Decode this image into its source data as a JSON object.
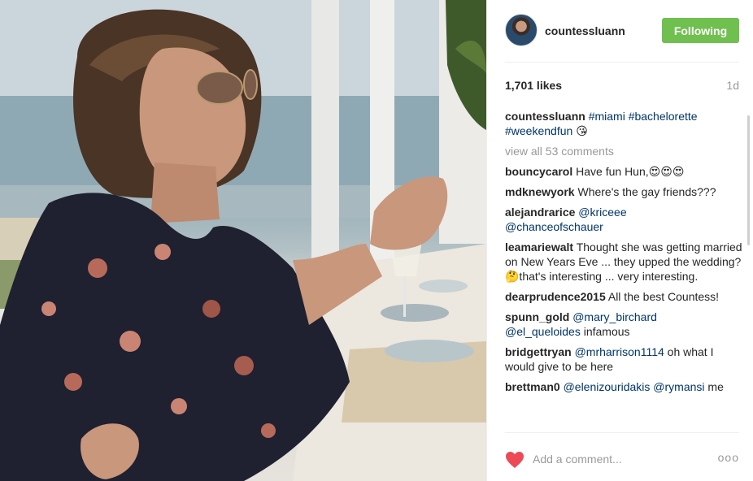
{
  "post": {
    "photo": {
      "subject": "photo"
    },
    "header": {
      "username": "countessluann",
      "follow_label": "Following",
      "avatar_icon": "avatar-icon"
    },
    "likes_label": "1,701 likes",
    "age_label": "1d",
    "caption": {
      "user": "countessluann",
      "tags": [
        "#miami",
        "#bachelorette",
        "#weekendfun"
      ],
      "emoji": "😘"
    },
    "view_all_label": "view all 53 comments",
    "comments": [
      {
        "user": "bouncycarol",
        "text": "Have fun Hun,😍😍😍"
      },
      {
        "user": "mdknewyork",
        "text": "Where's the gay friends???"
      },
      {
        "user": "alejandrarice",
        "mention1": "@kriceee",
        "mention2": "@chanceofschauer"
      },
      {
        "user": "leamariewalt",
        "text": "Thought she was getting married on New Years Eve ... they upped the wedding? 🤔that's interesting ... very interesting."
      },
      {
        "user": "dearprudence2015",
        "text": "All the best Countess!"
      },
      {
        "user": "spunn_gold",
        "mention1": "@mary_birchard",
        "mention2": "@el_queloides",
        "text": "infamous"
      },
      {
        "user": "bridgettryan",
        "mention1": "@mrharrison1114",
        "text": "oh what I would give to be here"
      },
      {
        "user": "brettman0",
        "mention1": "@elenizouridakis",
        "mention2": "@rymansi",
        "text": "me"
      }
    ],
    "footer": {
      "comment_placeholder": "Add a comment...",
      "more_label": "ooo",
      "heart_icon": "heart-icon"
    },
    "colors": {
      "follow_green": "#70c050",
      "link_blue": "#003569",
      "muted_grey": "#999999",
      "heart_red": "#ed4956"
    }
  }
}
